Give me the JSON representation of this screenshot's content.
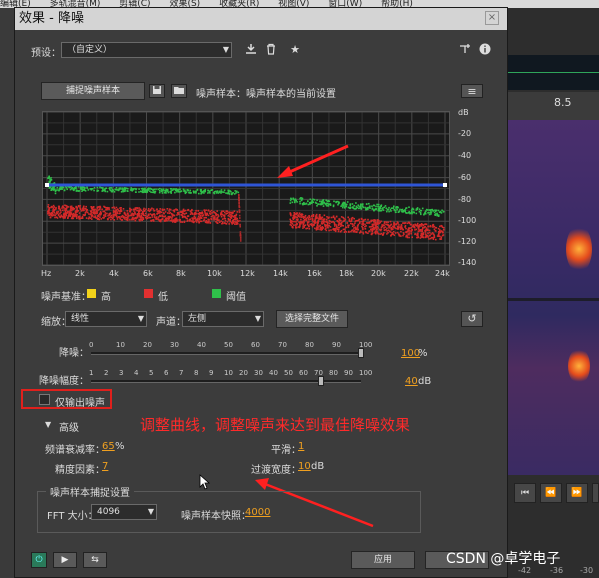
{
  "bg_app": {
    "menu": [
      "编辑(E)",
      "多轨混音(M)",
      "剪辑(C)",
      "效果(S)",
      "收藏夹(R)",
      "视图(V)",
      "窗口(W)",
      "帮助(H)"
    ],
    "ruler_value": "8.5",
    "transport_icons": [
      "skip-back-icon",
      "rewind-icon",
      "fast-forward-icon",
      "skip-forward-icon"
    ],
    "bottom_ruler_labels": [
      "-42",
      "-36",
      "-30"
    ]
  },
  "dialog": {
    "title": "效果 - 降噪",
    "close_glyph": "×",
    "preset_label": "预设：",
    "preset_value": "（自定义）",
    "capture_button": "捕捉噪声样本",
    "noise_sample_text": "噪声样本：噪声样本的当前设置",
    "graph": {
      "y_labels": [
        "dB",
        "-20",
        "-40",
        "-60",
        "-80",
        "-100",
        "-120",
        "-140"
      ],
      "x_labels": [
        "Hz",
        "2k",
        "4k",
        "6k",
        "8k",
        "10k",
        "12k",
        "14k",
        "16k",
        "18k",
        "20k",
        "22k",
        "24k"
      ]
    },
    "noise_floor_label": "噪声基准：",
    "legend": [
      {
        "label": "高",
        "color": "#f2d21a"
      },
      {
        "label": "低",
        "color": "#e23030"
      },
      {
        "label": "阈值",
        "color": "#2fc04a"
      }
    ],
    "scale_label": "缩放：",
    "scale_value": "线性",
    "channel_label": "声道：",
    "channel_value": "左侧",
    "select_all_button": "选择完整文件",
    "reduce_label": "降噪：",
    "reduce_ticks": [
      "0",
      "10",
      "20",
      "30",
      "40",
      "50",
      "60",
      "70",
      "80",
      "90",
      "100"
    ],
    "reduce_value": "100",
    "reduce_unit": "%",
    "reduce_fraction": 1.0,
    "amount_label": "降噪幅度：",
    "amount_ticks": [
      "1",
      "2",
      "3",
      "4",
      "5",
      "6",
      "7",
      "8",
      "9",
      "10",
      "20",
      "30",
      "40",
      "50",
      "60",
      "70",
      "80",
      "90",
      "100"
    ],
    "amount_value": "40",
    "amount_unit": "dB",
    "amount_fraction": 0.85,
    "output_noise_only": "仅输出噪声",
    "advanced_label": "高级",
    "spectral_decay_label": "频谱衰减率：",
    "spectral_decay_value": "65",
    "spectral_decay_unit": "%",
    "smoothing_label": "平滑：",
    "smoothing_value": "1",
    "precision_label": "精度因素：",
    "precision_value": "7",
    "transition_label": "过渡宽度：",
    "transition_value": "10",
    "transition_unit": "dB",
    "capture_settings_label": "噪声样本捕捉设置",
    "fft_label": "FFT 大小：",
    "fft_value": "4096",
    "snapshot_label": "噪声样本快照：",
    "snapshot_value": "4000",
    "apply_button": "应用",
    "annotation": "调整曲线，调整噪声来达到最佳降噪效果",
    "watermark": "CSDN @卓学电子"
  }
}
